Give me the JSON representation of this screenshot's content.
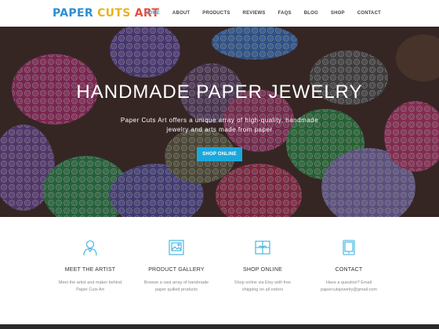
{
  "logo": {
    "parts": [
      "PAPER",
      " ",
      "CUTS",
      " ",
      "ART"
    ]
  },
  "nav": {
    "items": [
      {
        "label": "HOME",
        "active": true
      },
      {
        "label": "ABOUT",
        "active": false
      },
      {
        "label": "PRODUCTS",
        "active": false
      },
      {
        "label": "REVIEWS",
        "active": false
      },
      {
        "label": "FAQS",
        "active": false
      },
      {
        "label": "BLOG",
        "active": false
      },
      {
        "label": "SHOP",
        "active": false
      },
      {
        "label": "CONTACT",
        "active": false
      }
    ]
  },
  "hero": {
    "title": "HANDMADE PAPER JEWELRY",
    "subtitle": "Paper Cuts Art offers a unique array of high-quality, handmade jewelry and arts made from paper",
    "button": "SHOP ONLINE"
  },
  "features": [
    {
      "title": "MEET THE ARTIST",
      "desc": "Meet the artist and maker behind Paper Cuts Art",
      "icon": "user-icon"
    },
    {
      "title": "PRODUCT GALLERY",
      "desc": "Browse a vast array of handmade paper quilled products",
      "icon": "gallery-icon"
    },
    {
      "title": "SHOP ONLINE",
      "desc": "Shop online via Etsy with free shipping on all orders",
      "icon": "gift-icon"
    },
    {
      "title": "CONTACT",
      "desc": "Have a question? Email papercutsjewelry@gmail.com",
      "icon": "phone-icon"
    }
  ],
  "colors": {
    "accent": "#1ba8dd",
    "nav_active": "#2aa4d5",
    "icon": "#3ab0e0"
  }
}
